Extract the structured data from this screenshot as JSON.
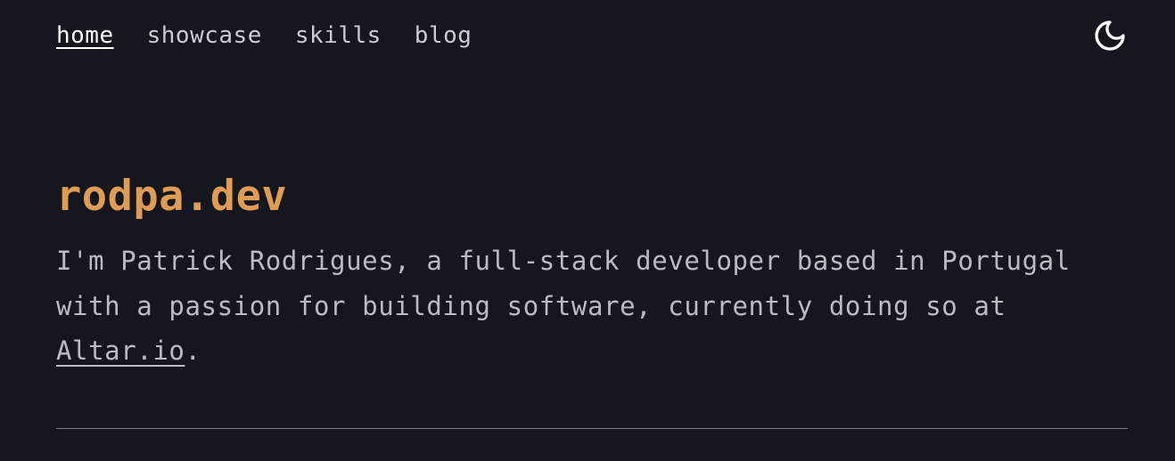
{
  "nav": {
    "items": [
      {
        "label": "home",
        "active": true
      },
      {
        "label": "showcase",
        "active": false
      },
      {
        "label": "skills",
        "active": false
      },
      {
        "label": "blog",
        "active": false
      }
    ],
    "theme_toggle_icon": "moon-icon"
  },
  "hero": {
    "title": "rodpa.dev",
    "intro_before_link": "I'm Patrick Rodrigues, a full-stack developer based in Portugal with a passion for building software, currently doing so at ",
    "link_text": "Altar.io",
    "intro_after_link": "."
  },
  "colors": {
    "background": "#15171f",
    "accent": "#e09b55",
    "text": "#b9bcc6",
    "active_nav": "#ffffff"
  }
}
